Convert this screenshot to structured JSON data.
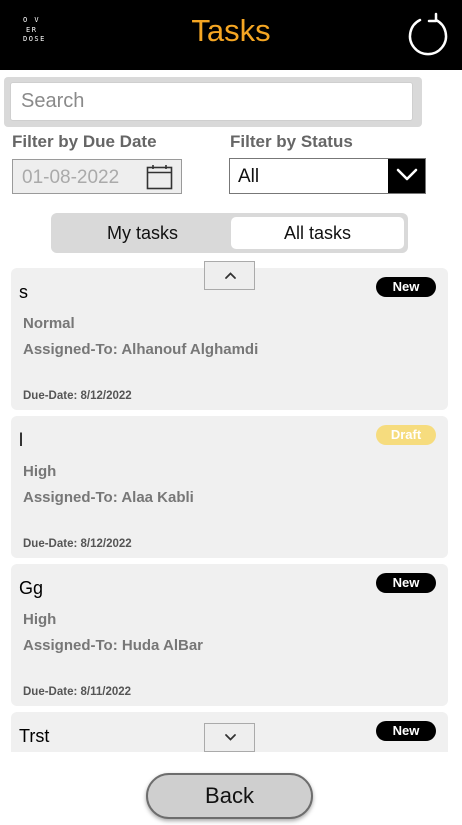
{
  "header": {
    "logo_lines": [
      "O V",
      "ER",
      "DOSE"
    ],
    "title": "Tasks",
    "title_color": "#f5a623",
    "refresh_icon": "refresh-icon"
  },
  "search": {
    "placeholder": "Search",
    "value": ""
  },
  "filters": {
    "due_date_label": "Filter by Due Date",
    "due_date_value": "01-08-2022",
    "status_label": "Filter by Status",
    "status_value": "All"
  },
  "toggle": {
    "options": [
      "My tasks",
      "All tasks"
    ],
    "selected": "All tasks"
  },
  "tasks": [
    {
      "name": "s",
      "priority": "Normal",
      "assigned": "Assigned-To: Alhanouf Alghamdi",
      "due": "Due-Date: 8/12/2022",
      "status": "New"
    },
    {
      "name": "l",
      "priority": "High",
      "assigned": "Assigned-To: Alaa Kabli",
      "due": "Due-Date: 8/12/2022",
      "status": "Draft"
    },
    {
      "name": "Gg",
      "priority": "High",
      "assigned": "Assigned-To: Huda AlBar",
      "due": "Due-Date: 8/11/2022",
      "status": "New"
    },
    {
      "name": "Trst",
      "priority": "",
      "assigned": "",
      "due": "",
      "status": "New"
    }
  ],
  "status_colors": {
    "New": {
      "bg": "#000000",
      "fg": "#ffffff"
    },
    "Draft": {
      "bg": "#f6dc7e",
      "fg": "#ffffff"
    }
  },
  "footer": {
    "back_label": "Back"
  }
}
